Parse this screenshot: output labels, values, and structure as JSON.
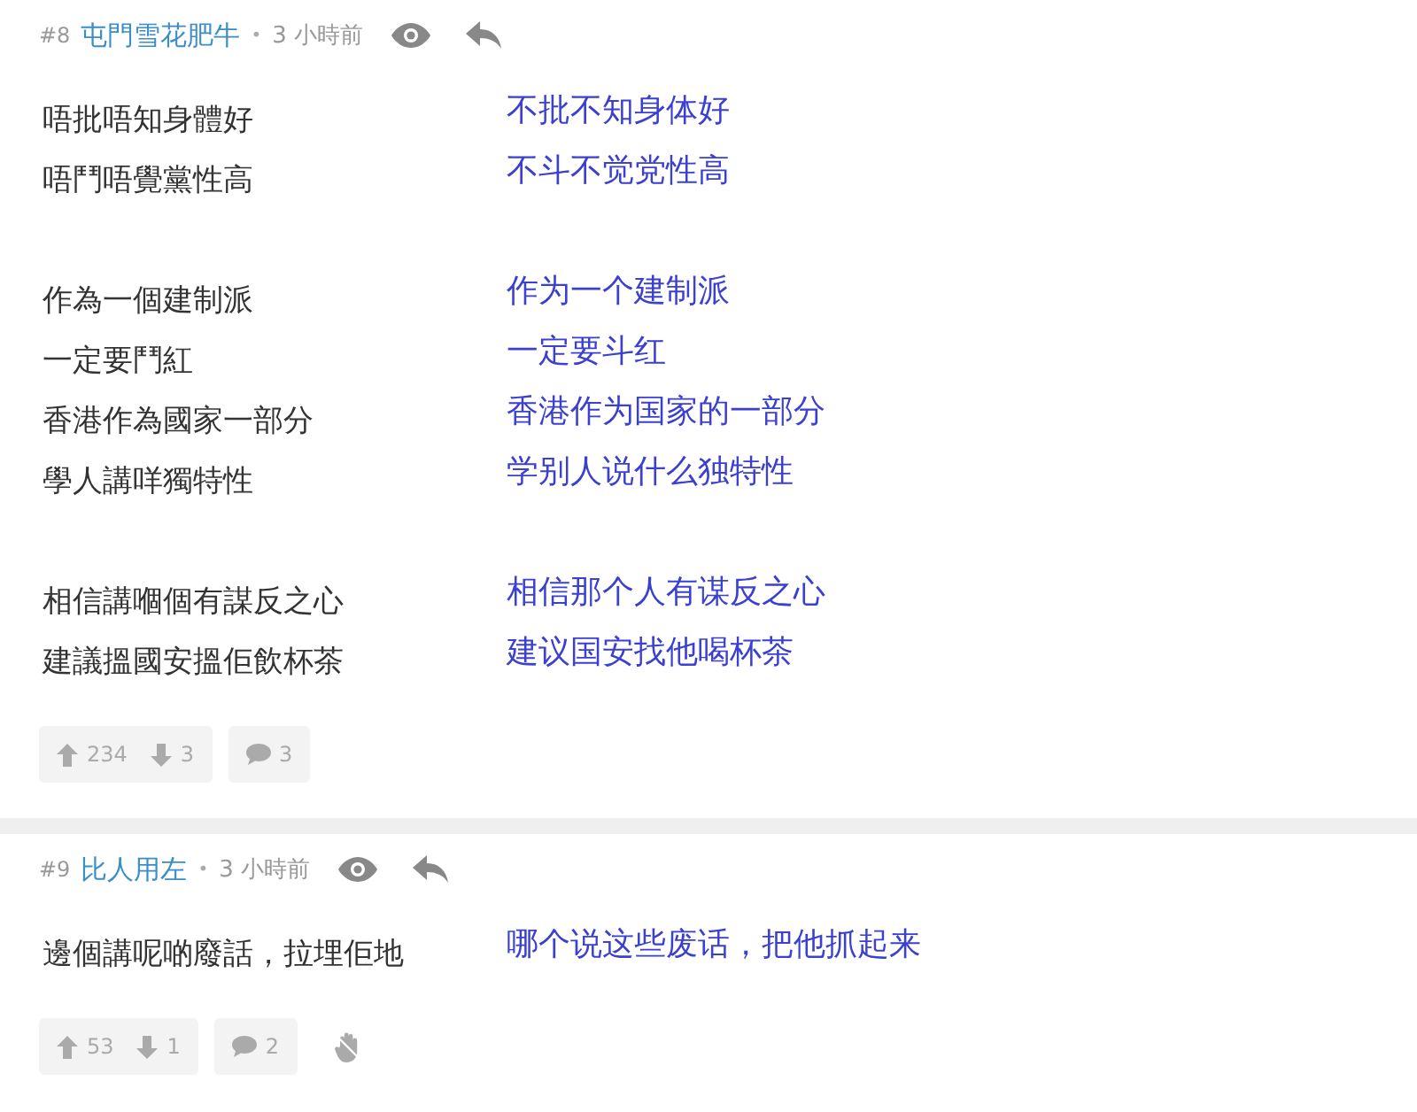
{
  "posts": [
    {
      "number": "#8",
      "author": "屯門雪花肥牛",
      "dot": "•",
      "time": "3 小時前",
      "stanzas": [
        [
          {
            "original": "唔批唔知身體好",
            "translation": "不批不知身体好"
          },
          {
            "original": "唔鬥唔覺黨性高",
            "translation": "不斗不觉党性高"
          }
        ],
        [
          {
            "original": "作為一個建制派",
            "translation": "作为一个建制派"
          },
          {
            "original": "一定要鬥紅",
            "translation": "一定要斗红"
          },
          {
            "original": "香港作為國家一部分",
            "translation": "香港作为国家的一部分"
          },
          {
            "original": "學人講咩獨特性",
            "translation": "学别人说什么独特性"
          }
        ],
        [
          {
            "original": "相信講嗰個有謀反之心",
            "translation": "相信那个人有谋反之心"
          },
          {
            "original": "建議搵國安搵佢飲杯茶",
            "translation": "建议国安找他喝杯茶"
          }
        ]
      ],
      "upvotes": "234",
      "downvotes": "3",
      "replies": "3",
      "hand_button": false
    },
    {
      "number": "#9",
      "author": "比人用左",
      "dot": "•",
      "time": "3 小時前",
      "stanzas": [
        [
          {
            "original": "邊個講呢啲廢話，拉埋佢地",
            "translation": "哪个说这些废话，把他抓起来"
          }
        ]
      ],
      "upvotes": "53",
      "downvotes": "1",
      "replies": "2",
      "hand_button": true
    }
  ]
}
